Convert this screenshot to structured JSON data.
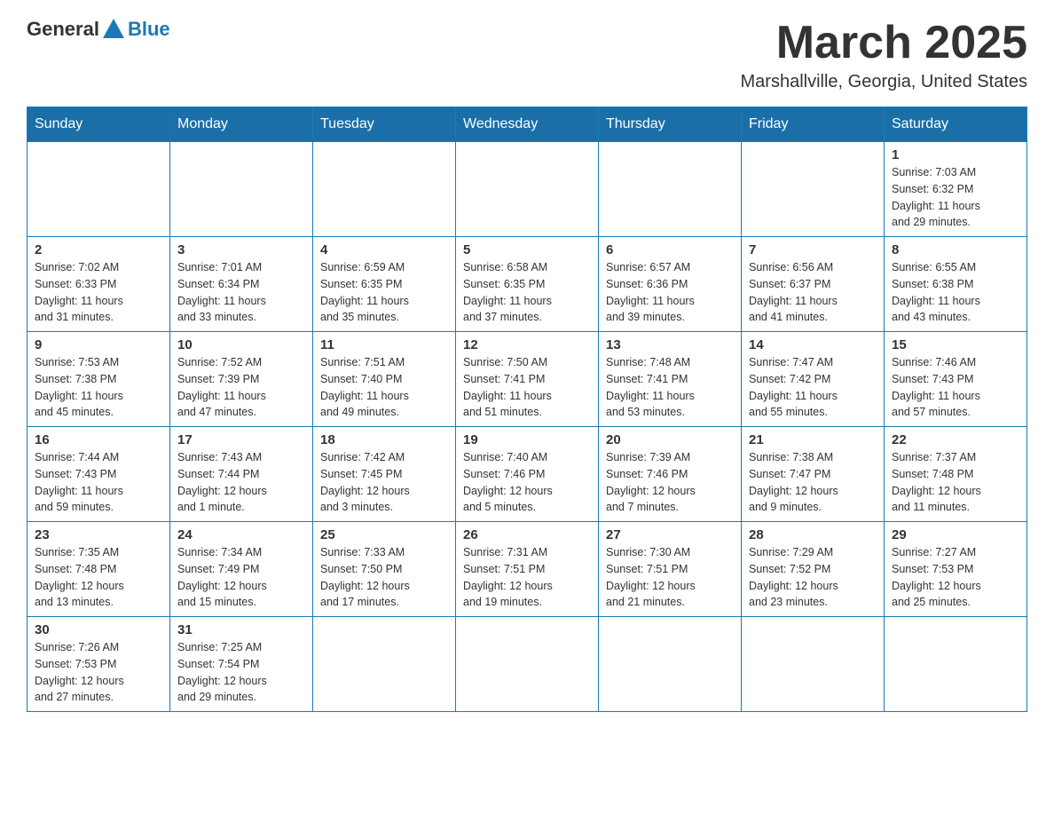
{
  "header": {
    "logo_general": "General",
    "logo_blue": "Blue",
    "month": "March 2025",
    "location": "Marshallville, Georgia, United States"
  },
  "weekdays": [
    "Sunday",
    "Monday",
    "Tuesday",
    "Wednesday",
    "Thursday",
    "Friday",
    "Saturday"
  ],
  "weeks": [
    [
      {
        "day": "",
        "info": ""
      },
      {
        "day": "",
        "info": ""
      },
      {
        "day": "",
        "info": ""
      },
      {
        "day": "",
        "info": ""
      },
      {
        "day": "",
        "info": ""
      },
      {
        "day": "",
        "info": ""
      },
      {
        "day": "1",
        "info": "Sunrise: 7:03 AM\nSunset: 6:32 PM\nDaylight: 11 hours\nand 29 minutes."
      }
    ],
    [
      {
        "day": "2",
        "info": "Sunrise: 7:02 AM\nSunset: 6:33 PM\nDaylight: 11 hours\nand 31 minutes."
      },
      {
        "day": "3",
        "info": "Sunrise: 7:01 AM\nSunset: 6:34 PM\nDaylight: 11 hours\nand 33 minutes."
      },
      {
        "day": "4",
        "info": "Sunrise: 6:59 AM\nSunset: 6:35 PM\nDaylight: 11 hours\nand 35 minutes."
      },
      {
        "day": "5",
        "info": "Sunrise: 6:58 AM\nSunset: 6:35 PM\nDaylight: 11 hours\nand 37 minutes."
      },
      {
        "day": "6",
        "info": "Sunrise: 6:57 AM\nSunset: 6:36 PM\nDaylight: 11 hours\nand 39 minutes."
      },
      {
        "day": "7",
        "info": "Sunrise: 6:56 AM\nSunset: 6:37 PM\nDaylight: 11 hours\nand 41 minutes."
      },
      {
        "day": "8",
        "info": "Sunrise: 6:55 AM\nSunset: 6:38 PM\nDaylight: 11 hours\nand 43 minutes."
      }
    ],
    [
      {
        "day": "9",
        "info": "Sunrise: 7:53 AM\nSunset: 7:38 PM\nDaylight: 11 hours\nand 45 minutes."
      },
      {
        "day": "10",
        "info": "Sunrise: 7:52 AM\nSunset: 7:39 PM\nDaylight: 11 hours\nand 47 minutes."
      },
      {
        "day": "11",
        "info": "Sunrise: 7:51 AM\nSunset: 7:40 PM\nDaylight: 11 hours\nand 49 minutes."
      },
      {
        "day": "12",
        "info": "Sunrise: 7:50 AM\nSunset: 7:41 PM\nDaylight: 11 hours\nand 51 minutes."
      },
      {
        "day": "13",
        "info": "Sunrise: 7:48 AM\nSunset: 7:41 PM\nDaylight: 11 hours\nand 53 minutes."
      },
      {
        "day": "14",
        "info": "Sunrise: 7:47 AM\nSunset: 7:42 PM\nDaylight: 11 hours\nand 55 minutes."
      },
      {
        "day": "15",
        "info": "Sunrise: 7:46 AM\nSunset: 7:43 PM\nDaylight: 11 hours\nand 57 minutes."
      }
    ],
    [
      {
        "day": "16",
        "info": "Sunrise: 7:44 AM\nSunset: 7:43 PM\nDaylight: 11 hours\nand 59 minutes."
      },
      {
        "day": "17",
        "info": "Sunrise: 7:43 AM\nSunset: 7:44 PM\nDaylight: 12 hours\nand 1 minute."
      },
      {
        "day": "18",
        "info": "Sunrise: 7:42 AM\nSunset: 7:45 PM\nDaylight: 12 hours\nand 3 minutes."
      },
      {
        "day": "19",
        "info": "Sunrise: 7:40 AM\nSunset: 7:46 PM\nDaylight: 12 hours\nand 5 minutes."
      },
      {
        "day": "20",
        "info": "Sunrise: 7:39 AM\nSunset: 7:46 PM\nDaylight: 12 hours\nand 7 minutes."
      },
      {
        "day": "21",
        "info": "Sunrise: 7:38 AM\nSunset: 7:47 PM\nDaylight: 12 hours\nand 9 minutes."
      },
      {
        "day": "22",
        "info": "Sunrise: 7:37 AM\nSunset: 7:48 PM\nDaylight: 12 hours\nand 11 minutes."
      }
    ],
    [
      {
        "day": "23",
        "info": "Sunrise: 7:35 AM\nSunset: 7:48 PM\nDaylight: 12 hours\nand 13 minutes."
      },
      {
        "day": "24",
        "info": "Sunrise: 7:34 AM\nSunset: 7:49 PM\nDaylight: 12 hours\nand 15 minutes."
      },
      {
        "day": "25",
        "info": "Sunrise: 7:33 AM\nSunset: 7:50 PM\nDaylight: 12 hours\nand 17 minutes."
      },
      {
        "day": "26",
        "info": "Sunrise: 7:31 AM\nSunset: 7:51 PM\nDaylight: 12 hours\nand 19 minutes."
      },
      {
        "day": "27",
        "info": "Sunrise: 7:30 AM\nSunset: 7:51 PM\nDaylight: 12 hours\nand 21 minutes."
      },
      {
        "day": "28",
        "info": "Sunrise: 7:29 AM\nSunset: 7:52 PM\nDaylight: 12 hours\nand 23 minutes."
      },
      {
        "day": "29",
        "info": "Sunrise: 7:27 AM\nSunset: 7:53 PM\nDaylight: 12 hours\nand 25 minutes."
      }
    ],
    [
      {
        "day": "30",
        "info": "Sunrise: 7:26 AM\nSunset: 7:53 PM\nDaylight: 12 hours\nand 27 minutes."
      },
      {
        "day": "31",
        "info": "Sunrise: 7:25 AM\nSunset: 7:54 PM\nDaylight: 12 hours\nand 29 minutes."
      },
      {
        "day": "",
        "info": ""
      },
      {
        "day": "",
        "info": ""
      },
      {
        "day": "",
        "info": ""
      },
      {
        "day": "",
        "info": ""
      },
      {
        "day": "",
        "info": ""
      }
    ]
  ]
}
